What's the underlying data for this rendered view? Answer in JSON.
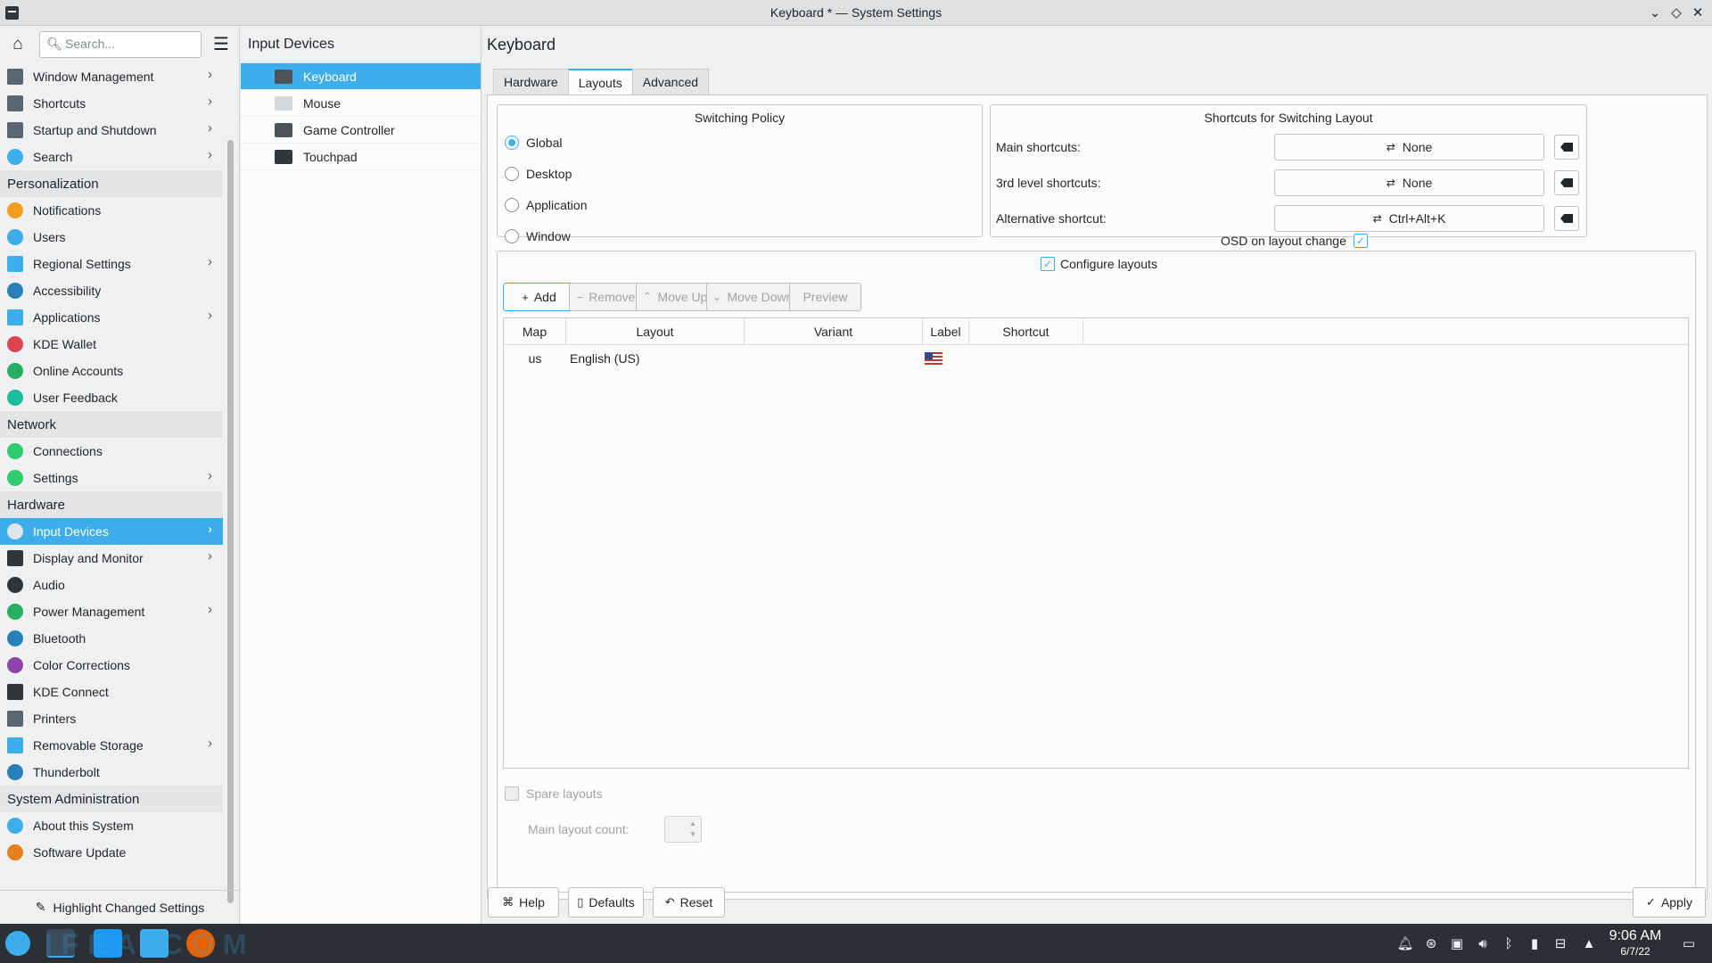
{
  "window": {
    "title": "Keyboard * — System Settings",
    "buttons": [
      "⌄",
      "◇",
      "✕"
    ]
  },
  "sidebar": {
    "search_placeholder": "Search...",
    "items": [
      {
        "label": "Window Management",
        "icon": "window-icon",
        "color": "#5b6670",
        "chev": true
      },
      {
        "label": "Shortcuts",
        "icon": "keyboard-shortcuts-icon",
        "color": "#5b6670",
        "chev": true
      },
      {
        "label": "Startup and Shutdown",
        "icon": "startup-icon",
        "color": "#5b6670",
        "chev": true
      },
      {
        "label": "Search",
        "icon": "search-icon",
        "color": "#3daee9",
        "chev": true
      },
      {
        "category": "Personalization"
      },
      {
        "label": "Notifications",
        "icon": "bell-icon",
        "color": "#f39c1f",
        "chev": false
      },
      {
        "label": "Users",
        "icon": "users-icon",
        "color": "#3daee9",
        "chev": false
      },
      {
        "label": "Regional Settings",
        "icon": "regional-icon",
        "color": "#3daee9",
        "chev": true
      },
      {
        "label": "Accessibility",
        "icon": "accessibility-icon",
        "color": "#2980b9",
        "chev": false
      },
      {
        "label": "Applications",
        "icon": "applications-icon",
        "color": "#3daee9",
        "chev": true
      },
      {
        "label": "KDE Wallet",
        "icon": "wallet-icon",
        "color": "#da4453",
        "chev": false
      },
      {
        "label": "Online Accounts",
        "icon": "online-accounts-icon",
        "color": "#27ae60",
        "chev": false
      },
      {
        "label": "User Feedback",
        "icon": "feedback-icon",
        "color": "#1abc9c",
        "chev": false
      },
      {
        "category": "Network"
      },
      {
        "label": "Connections",
        "icon": "connections-icon",
        "color": "#2ecc71",
        "chev": false
      },
      {
        "label": "Settings",
        "icon": "network-settings-icon",
        "color": "#2ecc71",
        "chev": true
      },
      {
        "category": "Hardware"
      },
      {
        "label": "Input Devices",
        "icon": "mouse-icon",
        "color": "#dfe6ec",
        "chev": true,
        "active": true
      },
      {
        "label": "Display and Monitor",
        "icon": "monitor-icon",
        "color": "#31363b",
        "chev": true
      },
      {
        "label": "Audio",
        "icon": "audio-icon",
        "color": "#31363b",
        "chev": false
      },
      {
        "label": "Power Management",
        "icon": "power-icon",
        "color": "#27ae60",
        "chev": true
      },
      {
        "label": "Bluetooth",
        "icon": "bluetooth-icon",
        "color": "#2980b9",
        "chev": false
      },
      {
        "label": "Color Corrections",
        "icon": "color-icon",
        "color": "#8e44ad",
        "chev": false
      },
      {
        "label": "KDE Connect",
        "icon": "kde-connect-icon",
        "color": "#31363b",
        "chev": false
      },
      {
        "label": "Printers",
        "icon": "printer-icon",
        "color": "#5b6670",
        "chev": false
      },
      {
        "label": "Removable Storage",
        "icon": "storage-icon",
        "color": "#3daee9",
        "chev": true
      },
      {
        "label": "Thunderbolt",
        "icon": "thunderbolt-icon",
        "color": "#2980b9",
        "chev": false
      },
      {
        "category": "System Administration"
      },
      {
        "label": "About this System",
        "icon": "info-icon",
        "color": "#3daee9",
        "chev": false
      },
      {
        "label": "Software Update",
        "icon": "update-icon",
        "color": "#e67e22",
        "chev": false
      }
    ],
    "footer_label": "Highlight Changed Settings"
  },
  "mid": {
    "title": "Input Devices",
    "items": [
      {
        "label": "Keyboard",
        "icon": "keyboard-icon",
        "active": true
      },
      {
        "label": "Mouse",
        "icon": "mouse-icon",
        "active": false
      },
      {
        "label": "Game Controller",
        "icon": "gamepad-icon",
        "active": false
      },
      {
        "label": "Touchpad",
        "icon": "touchpad-icon",
        "active": false
      }
    ]
  },
  "content": {
    "title": "Keyboard",
    "tabs": [
      "Hardware",
      "Layouts",
      "Advanced"
    ],
    "active_tab": "Layouts",
    "switching": {
      "title": "Switching Policy",
      "options": [
        "Global",
        "Desktop",
        "Application",
        "Window"
      ],
      "selected": "Global"
    },
    "shortcuts": {
      "title": "Shortcuts for Switching Layout",
      "rows": [
        {
          "label": "Main shortcuts:",
          "value": "None"
        },
        {
          "label": "3rd level shortcuts:",
          "value": "None"
        },
        {
          "label": "Alternative shortcut:",
          "value": "Ctrl+Alt+K"
        }
      ],
      "osd_label": "OSD on layout change"
    },
    "configure_label": "Configure layouts",
    "buttons": {
      "add": "Add",
      "remove": "Remove",
      "move_up": "Move Up",
      "move_down": "Move Down",
      "preview": "Preview"
    },
    "table": {
      "headers": [
        "Map",
        "Layout",
        "Variant",
        "Label",
        "Shortcut"
      ],
      "rows": [
        {
          "map": "us",
          "layout": "English (US)",
          "variant": "",
          "label_flag": "us-flag",
          "shortcut": ""
        }
      ]
    },
    "spare_layouts": "Spare layouts",
    "main_layout_count": "Main layout count:"
  },
  "footer": {
    "help": "Help",
    "defaults": "Defaults",
    "reset": "Reset",
    "apply": "Apply"
  },
  "taskbar": {
    "time": "9:06 AM",
    "date": "6/7/22",
    "watermark": "IFEA.COM"
  }
}
